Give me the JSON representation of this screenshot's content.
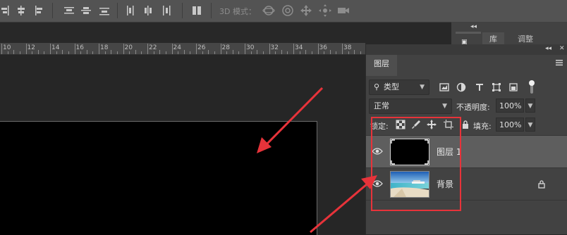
{
  "options_bar": {
    "mode_3d_label": "3D 模式："
  },
  "right_mini_panel": {
    "tabs": [
      "库",
      "调整"
    ]
  },
  "ruler": {
    "labels": [
      "10",
      "12",
      "14",
      "16",
      "18",
      "20",
      "22",
      "24",
      "26",
      "28",
      "30",
      "32",
      "34",
      "36",
      "38"
    ]
  },
  "layers_panel": {
    "tab_title": "图层",
    "filter": {
      "label": "类型"
    },
    "blend_mode": "正常",
    "opacity": {
      "label": "不透明度:",
      "value": "100%"
    },
    "lock": {
      "label": "锁定:"
    },
    "fill": {
      "label": "填充:",
      "value": "100%"
    },
    "layers": [
      {
        "name": "图层 1",
        "selected": true,
        "visible": true,
        "locked": false
      },
      {
        "name": "背景",
        "selected": false,
        "visible": true,
        "locked": true
      }
    ]
  },
  "annotations": {
    "highlight_color": "#e7333a"
  }
}
